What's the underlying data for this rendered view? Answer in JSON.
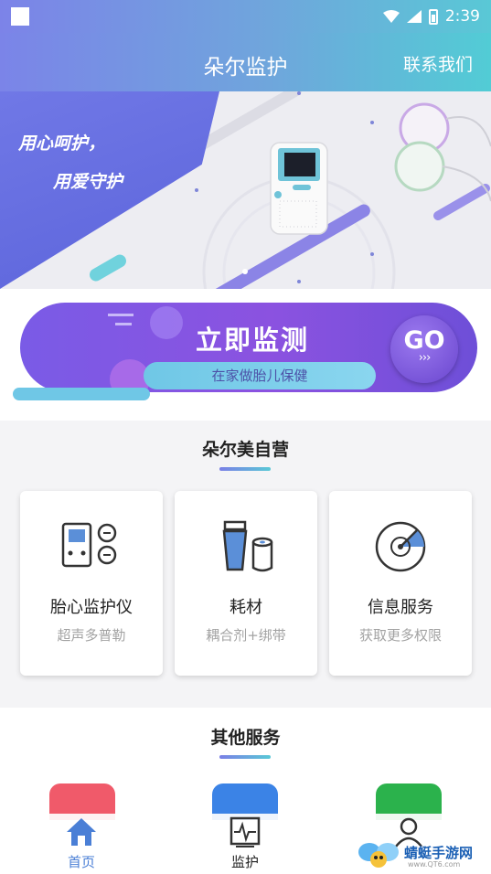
{
  "status_bar": {
    "time": "2:39"
  },
  "app_bar": {
    "title": "朵尔监护",
    "contact_label": "联系我们"
  },
  "banner": {
    "slogan_line1": "用心呵护，",
    "slogan_line2": "用爱守护"
  },
  "monitor_button": {
    "headline": "立即监测",
    "subtitle": "在家做胎儿保健",
    "go_label": "GO",
    "go_arrows": "›››"
  },
  "self_operated": {
    "title": "朵尔美自营",
    "cards": [
      {
        "name": "胎心监护仪",
        "sub": "超声多普勒",
        "icon": "fetal-monitor-icon"
      },
      {
        "name": "耗材",
        "sub": "耦合剂+绑带",
        "icon": "consumables-icon"
      },
      {
        "name": "信息服务",
        "sub": "获取更多权限",
        "icon": "radar-icon"
      }
    ]
  },
  "other_services": {
    "title": "其他服务"
  },
  "tabs": [
    {
      "label": "首页",
      "icon": "home-icon",
      "active": true
    },
    {
      "label": "监护",
      "icon": "monitor-tab-icon",
      "active": false
    },
    {
      "label": "",
      "icon": "profile-icon",
      "active": false
    }
  ],
  "watermark": {
    "text": "蜻蜓手游网",
    "url": "www.QT6.com"
  },
  "colors": {
    "accent_blue": "#5b8fd8",
    "purple": "#7b5be6",
    "cyan": "#59c8d6",
    "red": "#f05a6a",
    "green": "#2bb24c"
  }
}
